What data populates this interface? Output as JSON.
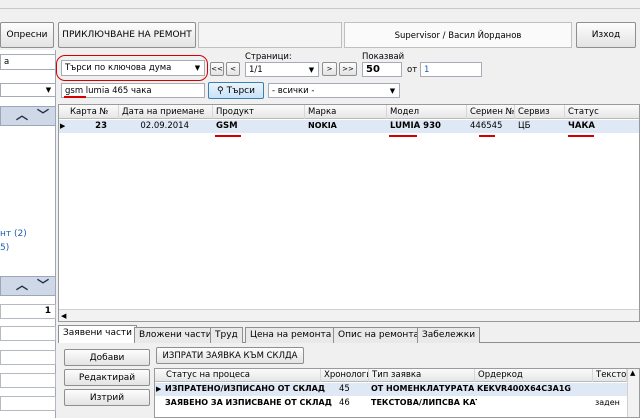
{
  "toolbar": {
    "refresh_label": "Опресни",
    "finish_repair_label": "ПРИКЛЮЧВАНЕ НА РЕМОНТ",
    "user_label": "Supervisor / Васил Йорданов",
    "exit_label": "Изход"
  },
  "search": {
    "mode_value": "Търси по ключова дума",
    "query_value": "gsm lumia 465 чака",
    "search_button_label": "Търси",
    "filter_value": "- всички -"
  },
  "paging": {
    "pages_label": "Страници:",
    "page_value": "1/1",
    "first_label": "<<",
    "prev_label": "<",
    "next_label": ">",
    "last_label": ">>",
    "show_label": "Показвай",
    "show_value": "50",
    "from_label": "от",
    "total_value": "1"
  },
  "left_panel": {
    "partial_a": "а",
    "link_1": "нт (2)",
    "link_2": "5)",
    "counter": "1"
  },
  "grid": {
    "columns": [
      "Карта №",
      "Дата на приемане",
      "Продукт",
      "Марка",
      "Модел",
      "Сериен №",
      "Сервиз",
      "Статус"
    ],
    "row": {
      "marker": "▶",
      "card": "23",
      "date": "02.09.2014",
      "product": "GSM",
      "brand": "NOKIA",
      "model": "LUMIA 930",
      "serial": "446545",
      "service": "ЦБ",
      "status": "ЧАКА"
    }
  },
  "tabs": [
    "Заявени части",
    "Вложени части",
    "Труд",
    "Цена на ремонта",
    "Опис на ремонта",
    "Забележки"
  ],
  "parts": {
    "add_label": "Добави",
    "edit_label": "Редактирай",
    "delete_label": "Изтрий",
    "send_request_label": "ИЗПРАТИ ЗАЯВКА КЪМ СКЛДА",
    "columns": [
      "Статус на процеса",
      "Хронология",
      "Тип заявка",
      "Ордеркод",
      "Тексто"
    ],
    "rows": [
      {
        "marker": "▶",
        "status": "ИЗПРАТЕНО/ИЗПИСАНО ОТ СКЛАД",
        "history": "45",
        "type": "ОТ НОМЕНКЛАТУРАТА",
        "ordercode": "KEKVR400X64C3A1G",
        "text": ""
      },
      {
        "marker": "",
        "status": "ЗАЯВЕНО ЗА ИЗПИСВАНЕ ОТ СКЛАД",
        "history": "46",
        "type": "ТЕКСТОВА/ЛИПСВА КАТ",
        "ordercode": "",
        "text": "заден"
      }
    ]
  },
  "colors": {
    "selection_row": "#dfe9f5",
    "underline": "#d40000",
    "highlight_oval": "#d40000",
    "panel_header": "#cfd8e6",
    "link": "#1a5fb4"
  }
}
